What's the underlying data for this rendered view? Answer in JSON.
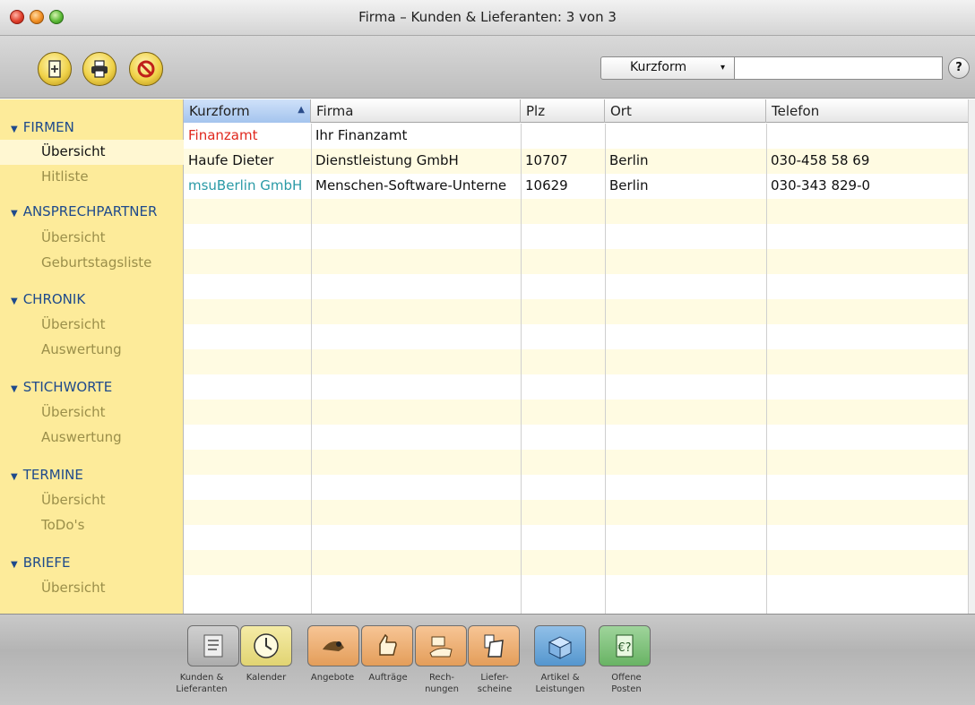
{
  "window": {
    "title": "Firma – Kunden & Lieferanten: 3 von 3"
  },
  "toolbar": {
    "buttons": [
      {
        "icon": "new-record-icon"
      },
      {
        "icon": "printer-icon"
      },
      {
        "icon": "cancel-icon"
      }
    ],
    "search": {
      "field_select": "Kurzform",
      "query": ""
    },
    "help_label": "?"
  },
  "sidebar": {
    "sections": [
      {
        "title": "FIRMEN",
        "items": [
          "Übersicht",
          "Hitliste"
        ]
      },
      {
        "title": "ANSPRECHPARTNER",
        "items": [
          "Übersicht",
          "Geburtstagsliste"
        ]
      },
      {
        "title": "CHRONIK",
        "items": [
          "Übersicht",
          "Auswertung"
        ]
      },
      {
        "title": "STICHWORTE",
        "items": [
          "Übersicht",
          "Auswertung"
        ]
      },
      {
        "title": "TERMINE",
        "items": [
          "Übersicht",
          "ToDo's"
        ]
      },
      {
        "title": "BRIEFE",
        "items": [
          "Übersicht"
        ]
      }
    ],
    "selected": "FIRMEN/Übersicht"
  },
  "table": {
    "columns": [
      "Kurzform",
      "Firma",
      "Plz",
      "Ort",
      "Telefon"
    ],
    "sorted_column": "Kurzform",
    "sort_direction": "ascending",
    "rows": [
      {
        "kurzform": "Finanzamt",
        "firma": "Ihr Finanzamt",
        "plz": "",
        "ort": "",
        "telefon": "",
        "color": "#e0281e"
      },
      {
        "kurzform": "Haufe Dieter",
        "firma": "Dienstleistung GmbH",
        "plz": "10707",
        "ort": "Berlin",
        "telefon": "030-458 58 69",
        "color": "#111111"
      },
      {
        "kurzform": "msuBerlin GmbH",
        "firma": "Menschen-Software-Unterne",
        "plz": "10629",
        "ort": "Berlin",
        "telefon": "030-343 829-0",
        "color": "#2a9aa6"
      }
    ]
  },
  "modules": [
    {
      "label": "Kunden &\nLieferanten",
      "icon": "contacts-icon",
      "color": "#b8b8b8"
    },
    {
      "label": "Kalender",
      "icon": "clock-icon",
      "color": "#f0e27a"
    },
    {
      "label": "Angebote",
      "icon": "offer-hand-icon",
      "color": "#f3a860"
    },
    {
      "label": "Aufträge",
      "icon": "thumbs-up-icon",
      "color": "#f3a860"
    },
    {
      "label": "Rech-\nnungen",
      "icon": "money-hand-icon",
      "color": "#f3a860"
    },
    {
      "label": "Liefer-\nscheine",
      "icon": "delivery-note-icon",
      "color": "#f3a860"
    },
    {
      "label": "Artikel &\nLeistungen",
      "icon": "box-icon",
      "color": "#5aa0dc"
    },
    {
      "label": "Offene\nPosten",
      "icon": "euro-receipt-icon",
      "color": "#6fbf6a"
    }
  ],
  "colors": {
    "sidebar_bg": "#fdeb9a",
    "row_alt_bg": "#fffbe2",
    "section_header": "#1e4a8c",
    "sorted_header": "#a4c4ee"
  }
}
